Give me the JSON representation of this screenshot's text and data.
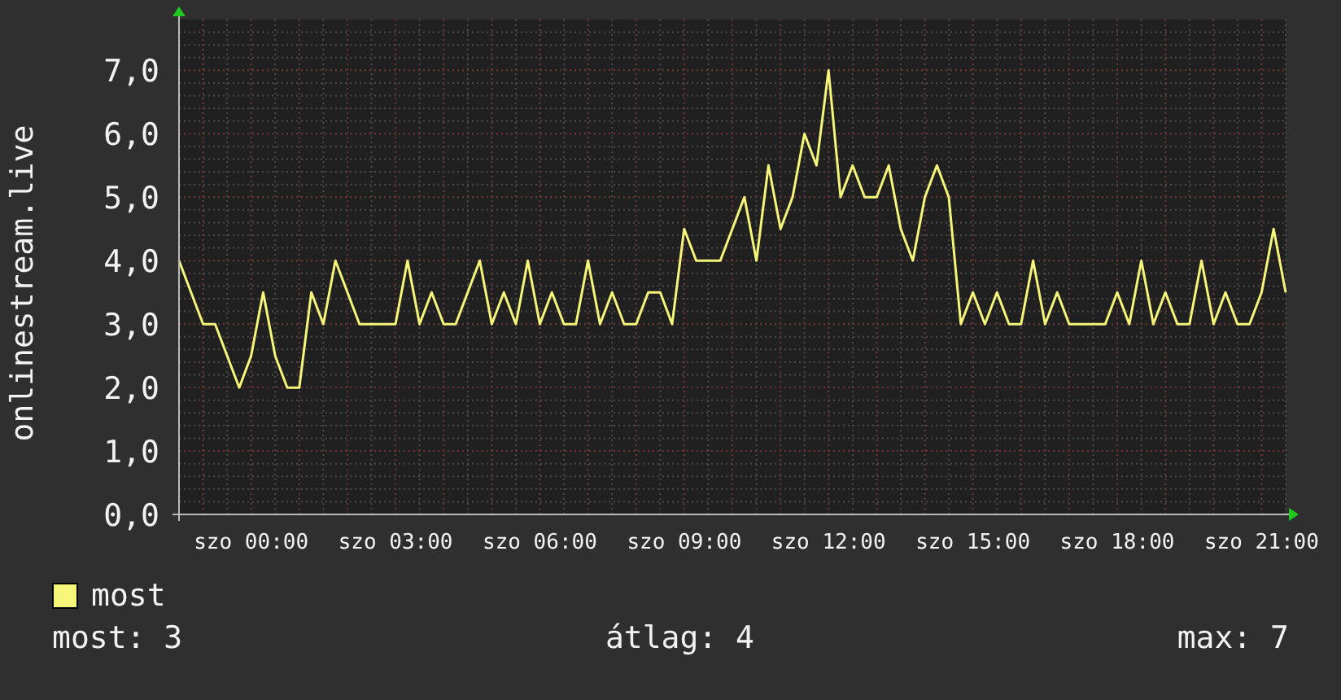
{
  "chart": {
    "chart_data": {
      "type": "line",
      "ylabel": "onlinestream.live",
      "categories": [
        null,
        null,
        null,
        null,
        null,
        null,
        "szo 00:00",
        null,
        null,
        null,
        null,
        null,
        null,
        null,
        null,
        null,
        null,
        null,
        "szo 03:00",
        null,
        null,
        null,
        null,
        null,
        null,
        null,
        null,
        null,
        null,
        null,
        "szo 06:00",
        null,
        null,
        null,
        null,
        null,
        null,
        null,
        null,
        null,
        null,
        null,
        "szo 09:00",
        null,
        null,
        null,
        null,
        null,
        null,
        null,
        null,
        null,
        null,
        null,
        "szo 12:00",
        null,
        null,
        null,
        null,
        null,
        null,
        null,
        null,
        null,
        null,
        null,
        "szo 15:00",
        null,
        null,
        null,
        null,
        null,
        null,
        null,
        null,
        null,
        null,
        null,
        "szo 18:00",
        null,
        null,
        null,
        null,
        null,
        null,
        null,
        null,
        null,
        null,
        null,
        "szo 21:00",
        null,
        null
      ],
      "series": [
        {
          "name": "most",
          "color": "#f5f57a",
          "values": [
            4,
            3.5,
            3,
            3,
            2.5,
            2,
            2.5,
            3.5,
            2.5,
            2,
            2,
            3.5,
            3,
            4,
            3.5,
            3,
            3,
            3,
            3,
            4,
            3,
            3.5,
            3,
            3,
            3.5,
            4,
            3,
            3.5,
            3,
            4,
            3,
            3.5,
            3,
            3,
            4,
            3,
            3.5,
            3,
            3,
            3.5,
            3.5,
            3,
            4.5,
            4,
            4,
            4,
            4.5,
            5,
            4,
            5.5,
            4.5,
            5,
            6,
            5.5,
            7,
            5,
            5.5,
            5,
            5,
            5.5,
            4.5,
            4,
            5,
            5.5,
            5,
            3,
            3.5,
            3,
            3.5,
            3,
            3,
            4,
            3,
            3.5,
            3,
            3,
            3,
            3,
            3.5,
            3,
            4,
            3,
            3.5,
            3,
            3,
            4,
            3,
            3.5,
            3,
            3,
            3.5,
            4.5,
            3.5
          ]
        }
      ],
      "ylim": [
        0,
        7.8
      ],
      "grid": true,
      "yticks": [
        {
          "value": 0,
          "label": "0,0"
        },
        {
          "value": 1,
          "label": "1,0"
        },
        {
          "value": 2,
          "label": "2,0"
        },
        {
          "value": 3,
          "label": "3,0"
        },
        {
          "value": 4,
          "label": "4,0"
        },
        {
          "value": 5,
          "label": "5,0"
        },
        {
          "value": 6,
          "label": "6,0"
        },
        {
          "value": 7,
          "label": "7,0"
        }
      ]
    }
  },
  "stats": [
    "most: 3",
    "átlag: 4",
    "max: 7"
  ]
}
